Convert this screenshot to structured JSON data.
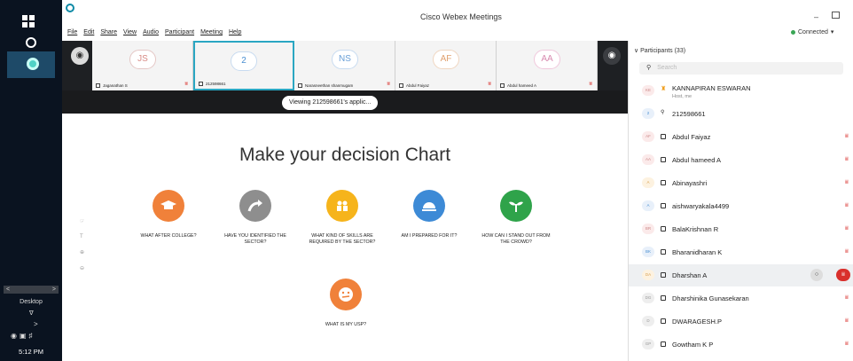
{
  "taskbar": {
    "desktop_label": "Desktop",
    "time": "5:12 PM"
  },
  "window": {
    "title": "Cisco Webex Meetings",
    "connection": "Connected"
  },
  "menu": [
    "File",
    "Edit",
    "Share",
    "View",
    "Audio",
    "Participant",
    "Meeting",
    "Help"
  ],
  "video_strip": {
    "tiles": [
      {
        "initials": "JS",
        "name": "Jaganathan S"
      },
      {
        "initials": "2",
        "name": "212598661"
      },
      {
        "initials": "NS",
        "name": "Narasneethan shanmugam"
      },
      {
        "initials": "AF",
        "name": "Abdul Faiyaz"
      },
      {
        "initials": "AA",
        "name": "Abdul hameed A"
      }
    ]
  },
  "share": {
    "viewing_label": "Viewing 212598661's applic...",
    "slide_title": "Make your decision Chart",
    "items": [
      {
        "caption": "WHAT AFTER COLLEGE?",
        "color": "#f0813a",
        "icon": "graduation-cap-icon"
      },
      {
        "caption": "HAVE YOU IDENTIFIED THE SECTOR?",
        "color": "#8e8e8e",
        "icon": "turn-arrow-icon"
      },
      {
        "caption": "WHAT KIND OF SKILLS ARE REQUIRED BY THE SECTOR?",
        "color": "#f6b41b",
        "icon": "people-icon"
      },
      {
        "caption": "AM I PREPARED FOR IT?",
        "color": "#3d8ad6",
        "icon": "food-tray-icon"
      },
      {
        "caption": "HOW CAN I STAND OUT FROM THE CROWD?",
        "color": "#2fa34a",
        "icon": "plant-icon"
      },
      {
        "caption": "WHAT IS MY USP?",
        "color": "#f0813a",
        "icon": "confused-face-icon"
      }
    ]
  },
  "participants": {
    "header": "Participants (33)",
    "search_placeholder": "Search",
    "list": [
      {
        "initials": "KE",
        "name": "KANNAPIRAN ESWARAN",
        "sub": "Host, me"
      },
      {
        "initials": "2",
        "name": "212598661"
      },
      {
        "initials": "AF",
        "name": "Abdul Faiyaz"
      },
      {
        "initials": "AA",
        "name": "Abdul hameed A"
      },
      {
        "initials": "A",
        "name": "Abinayashri"
      },
      {
        "initials": "A",
        "name": "aishwaryakala4499"
      },
      {
        "initials": "BR",
        "name": "BalaKrishnan R"
      },
      {
        "initials": "BK",
        "name": "Bharanidharan K"
      },
      {
        "initials": "DA",
        "name": "Dharshan A"
      },
      {
        "initials": "DG",
        "name": "Dharshinika Gunasekaran"
      },
      {
        "initials": "D",
        "name": "DWARAGESH.P"
      },
      {
        "initials": "GP",
        "name": "Gowtham K P"
      }
    ]
  }
}
